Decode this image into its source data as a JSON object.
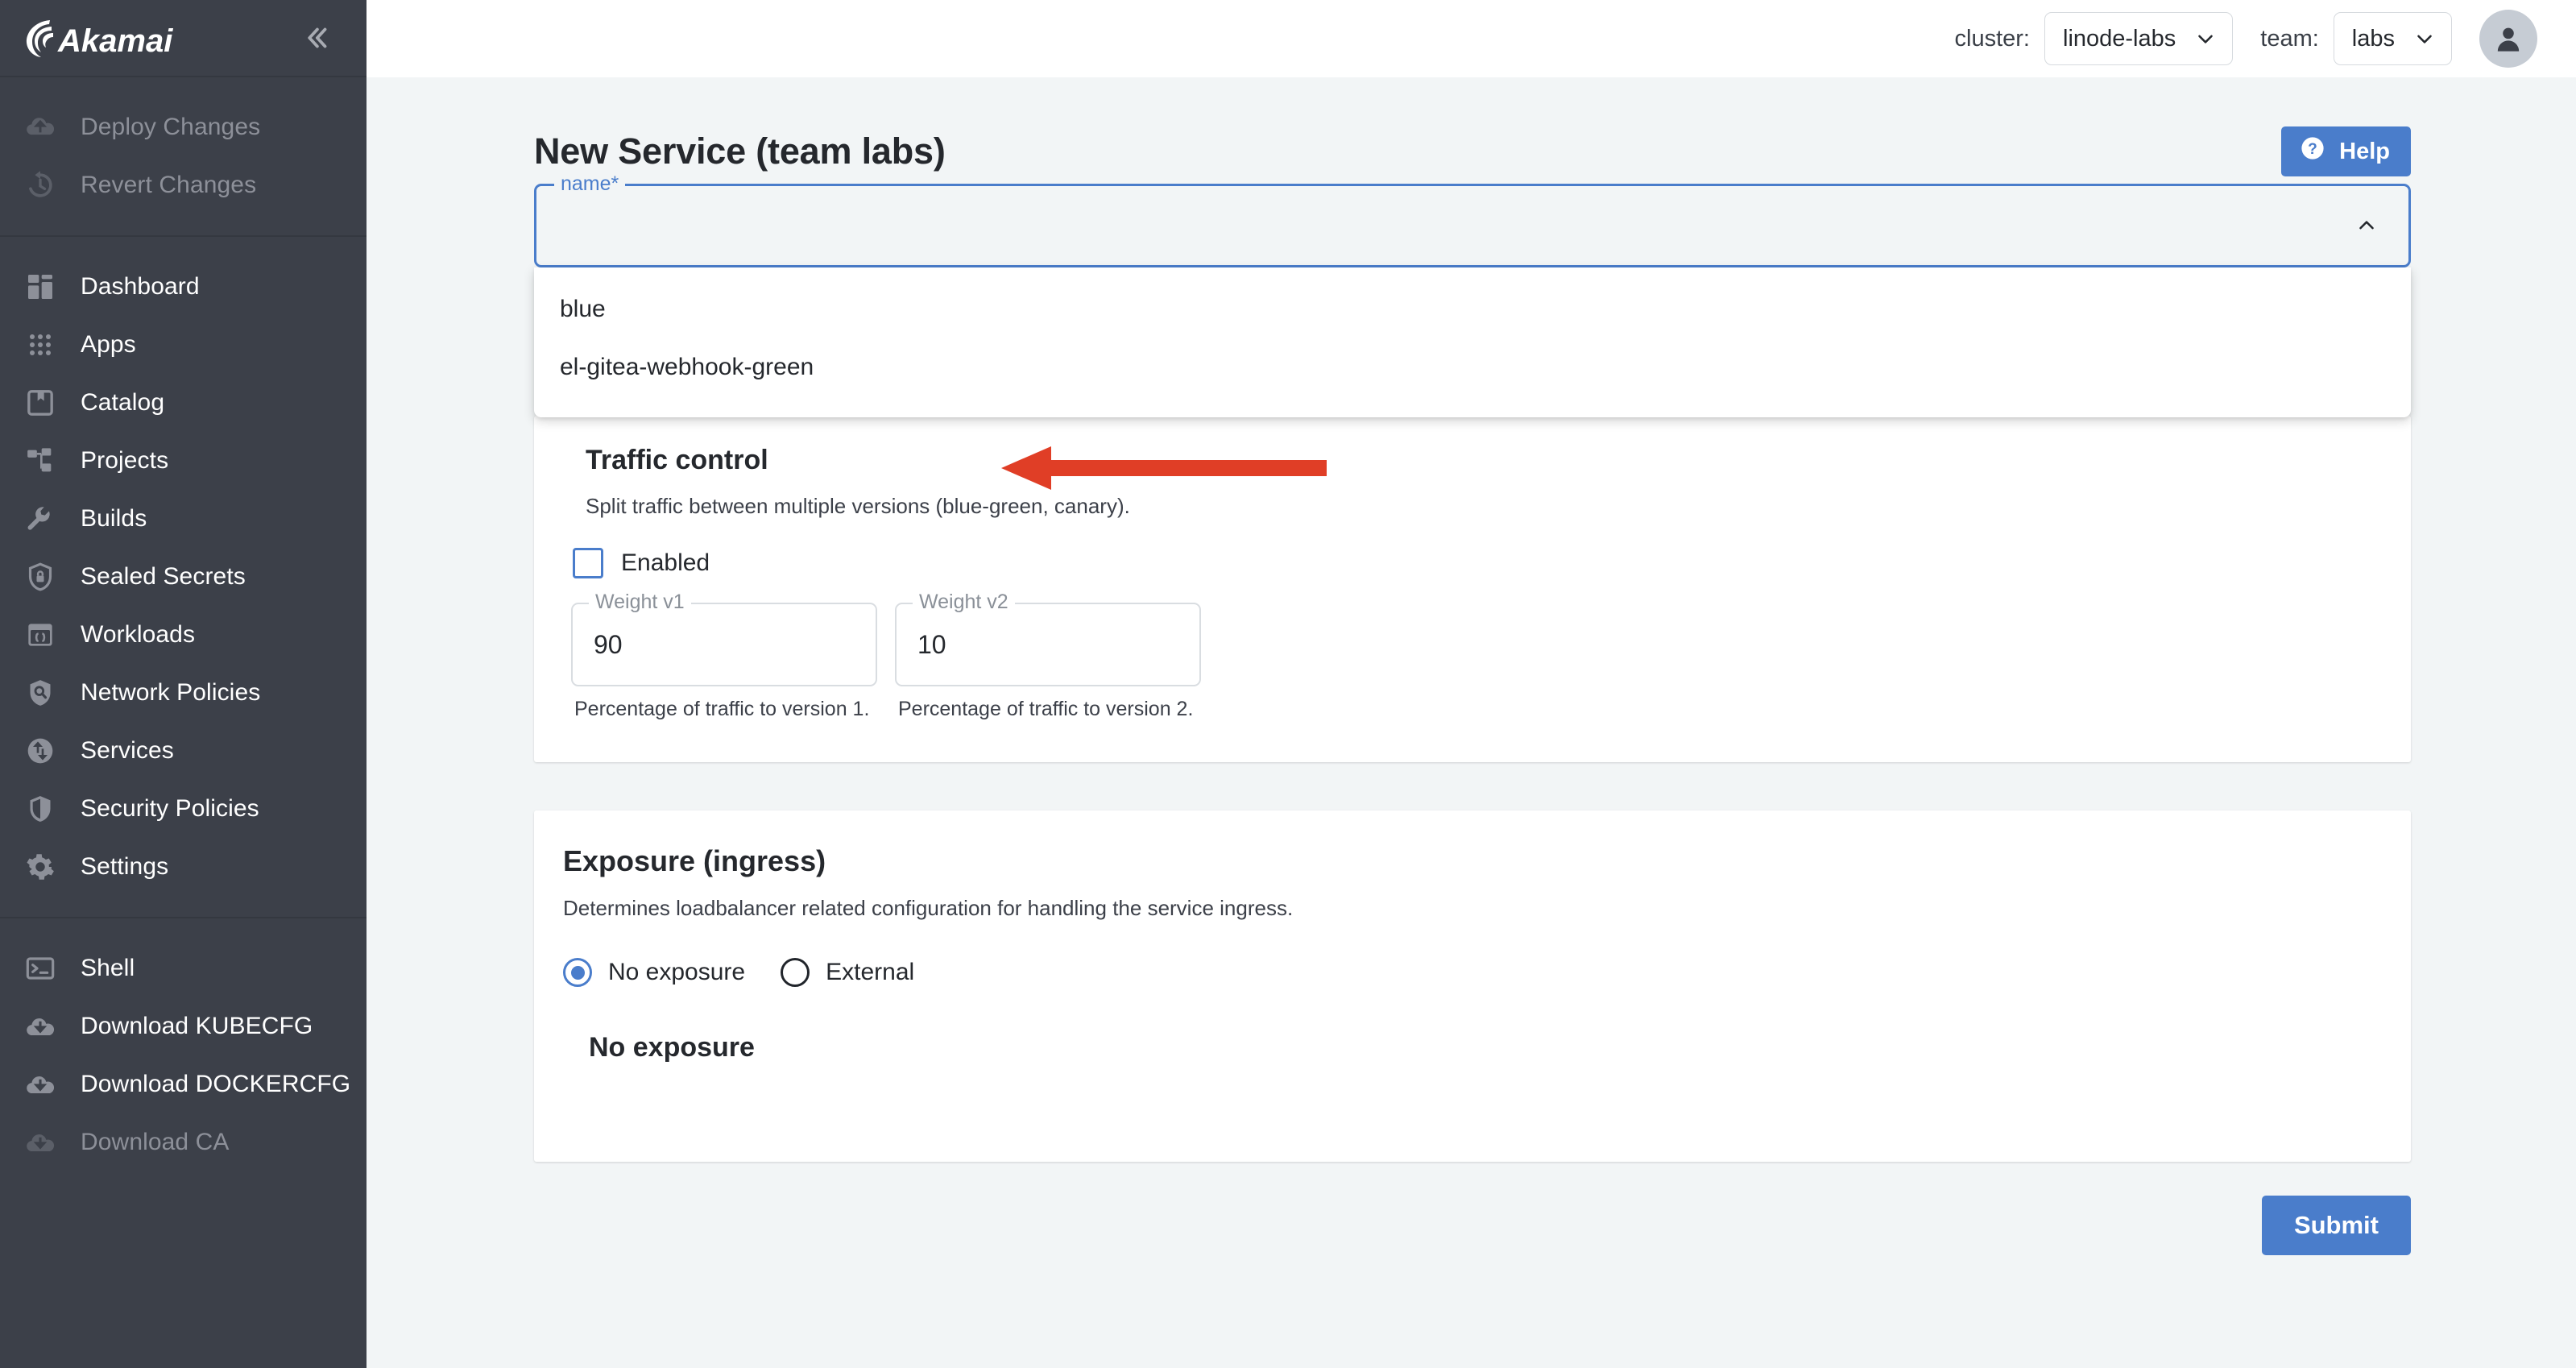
{
  "brand": {
    "logo_text": "Akamai",
    "collapse_icon": "chevron-double-left-icon"
  },
  "sidebar": {
    "groups": [
      {
        "items": [
          {
            "label": "Deploy Changes",
            "icon": "cloud-upload-icon",
            "dim": true
          },
          {
            "label": "Revert Changes",
            "icon": "history-revert-icon",
            "dim": true
          }
        ]
      },
      {
        "items": [
          {
            "label": "Dashboard",
            "icon": "dashboard-grid-icon",
            "dim": false
          },
          {
            "label": "Apps",
            "icon": "apps-dots-icon",
            "dim": false
          },
          {
            "label": "Catalog",
            "icon": "catalog-book-icon",
            "dim": false
          },
          {
            "label": "Projects",
            "icon": "projects-hierarchy-icon",
            "dim": false
          },
          {
            "label": "Builds",
            "icon": "wrench-icon",
            "dim": false
          },
          {
            "label": "Sealed Secrets",
            "icon": "shield-lock-icon",
            "dim": false
          },
          {
            "label": "Workloads",
            "icon": "workloads-brackets-icon",
            "dim": false
          },
          {
            "label": "Network Policies",
            "icon": "shield-search-icon",
            "dim": false
          },
          {
            "label": "Services",
            "icon": "services-exchange-icon",
            "dim": false
          },
          {
            "label": "Security Policies",
            "icon": "shield-half-icon",
            "dim": false
          },
          {
            "label": "Settings",
            "icon": "gear-icon",
            "dim": false
          }
        ]
      },
      {
        "items": [
          {
            "label": "Shell",
            "icon": "terminal-icon",
            "dim": false
          },
          {
            "label": "Download KUBECFG",
            "icon": "cloud-download-icon",
            "dim": false
          },
          {
            "label": "Download DOCKERCFG",
            "icon": "cloud-download-icon",
            "dim": false
          },
          {
            "label": "Download CA",
            "icon": "cloud-download-icon",
            "dim": true
          }
        ]
      }
    ]
  },
  "topbar": {
    "cluster_label": "cluster:",
    "cluster_value": "linode-labs",
    "team_label": "team:",
    "team_value": "labs",
    "chevron_icon": "chevron-down-icon",
    "avatar_icon": "user-avatar-icon"
  },
  "page": {
    "title": "New Service (team labs)",
    "help_label": "Help",
    "help_icon": "question-circle-icon"
  },
  "name_field": {
    "legend": "name",
    "required_mark": "*",
    "value": "",
    "chevron_icon": "chevron-up-icon",
    "open": true,
    "options": [
      {
        "label": "blue"
      },
      {
        "label": "el-gitea-webhook-green"
      }
    ]
  },
  "traffic_control": {
    "title": "Traffic control",
    "subtitle": "Split traffic between multiple versions (blue-green, canary).",
    "enabled_label": "Enabled",
    "enabled_checked": false,
    "weight_v1": {
      "legend": "Weight v1",
      "value": "90",
      "help": "Percentage of traffic to version 1."
    },
    "weight_v2": {
      "legend": "Weight v2",
      "value": "10",
      "help": "Percentage of traffic to version 2."
    }
  },
  "exposure": {
    "title": "Exposure (ingress)",
    "subtitle": "Determines loadbalancer related configuration for handling the service ingress.",
    "options": [
      {
        "label": "No exposure",
        "selected": true
      },
      {
        "label": "External",
        "selected": false
      }
    ],
    "mode_heading": "No exposure"
  },
  "footer": {
    "submit_label": "Submit"
  },
  "annotation": {
    "type": "arrow-left",
    "color": "#e03e26",
    "points_to": "blue"
  },
  "colors": {
    "sidebar_bg": "#3c4049",
    "page_bg": "#f2f5f6",
    "accent_blue": "#4a7dcb",
    "annotation_red": "#e03e26"
  }
}
